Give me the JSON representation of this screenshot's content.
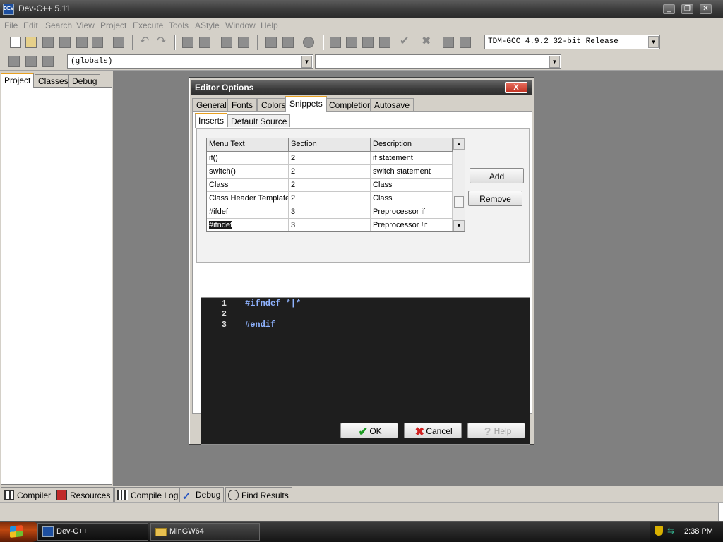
{
  "window": {
    "title": "Dev-C++ 5.11",
    "icon_text": "DEV"
  },
  "menu": [
    "File",
    "Edit",
    "Search",
    "View",
    "Project",
    "Execute",
    "Tools",
    "AStyle",
    "Window",
    "Help"
  ],
  "compiler_select": {
    "value": "TDM-GCC 4.9.2 32-bit Release"
  },
  "scope_select": {
    "value": "(globals)"
  },
  "member_select": {
    "value": ""
  },
  "left_tabs": [
    "Project",
    "Classes",
    "Debug"
  ],
  "bottom_tabs": [
    "Compiler",
    "Resources",
    "Compile Log",
    "Debug",
    "Find Results"
  ],
  "dialog": {
    "title": "Editor Options",
    "close_label": "X",
    "tabs": [
      "General",
      "Fonts",
      "Colors",
      "Snippets",
      "Completion",
      "Autosave"
    ],
    "active_tab": "Snippets",
    "subtabs": [
      "Inserts",
      "Default Source"
    ],
    "active_subtab": "Inserts",
    "grid": {
      "headers": [
        "Menu Text",
        "Section",
        "Description"
      ],
      "rows": [
        {
          "menu": "if()",
          "section": "2",
          "desc": "if statement"
        },
        {
          "menu": "switch()",
          "section": "2",
          "desc": "switch statement"
        },
        {
          "menu": "Class",
          "section": "2",
          "desc": "Class"
        },
        {
          "menu": "Class Header Template",
          "section": "2",
          "desc": "Class"
        },
        {
          "menu": "#ifdef",
          "section": "3",
          "desc": "Preprocessor if"
        },
        {
          "menu": "#ifndef",
          "section": "3",
          "desc": "Preprocessor !if"
        }
      ],
      "selected_row": 5
    },
    "add_label": "Add",
    "remove_label": "Remove",
    "code_lines": [
      {
        "num": "1",
        "text": "#ifndef *|*"
      },
      {
        "num": "2",
        "text": ""
      },
      {
        "num": "3",
        "text": "#endif"
      }
    ],
    "ok_label": "OK",
    "cancel_label": "Cancel",
    "help_label": "Help"
  },
  "taskbar": {
    "tasks": [
      {
        "label": "Dev-C++"
      },
      {
        "label": "MinGW64"
      }
    ],
    "clock": "2:38 PM"
  },
  "colors": {
    "accent_tab": "#e8a020",
    "editor_bg": "#1e1e1e",
    "code_text": "#8fb3ff",
    "close_red": "#c03020"
  }
}
